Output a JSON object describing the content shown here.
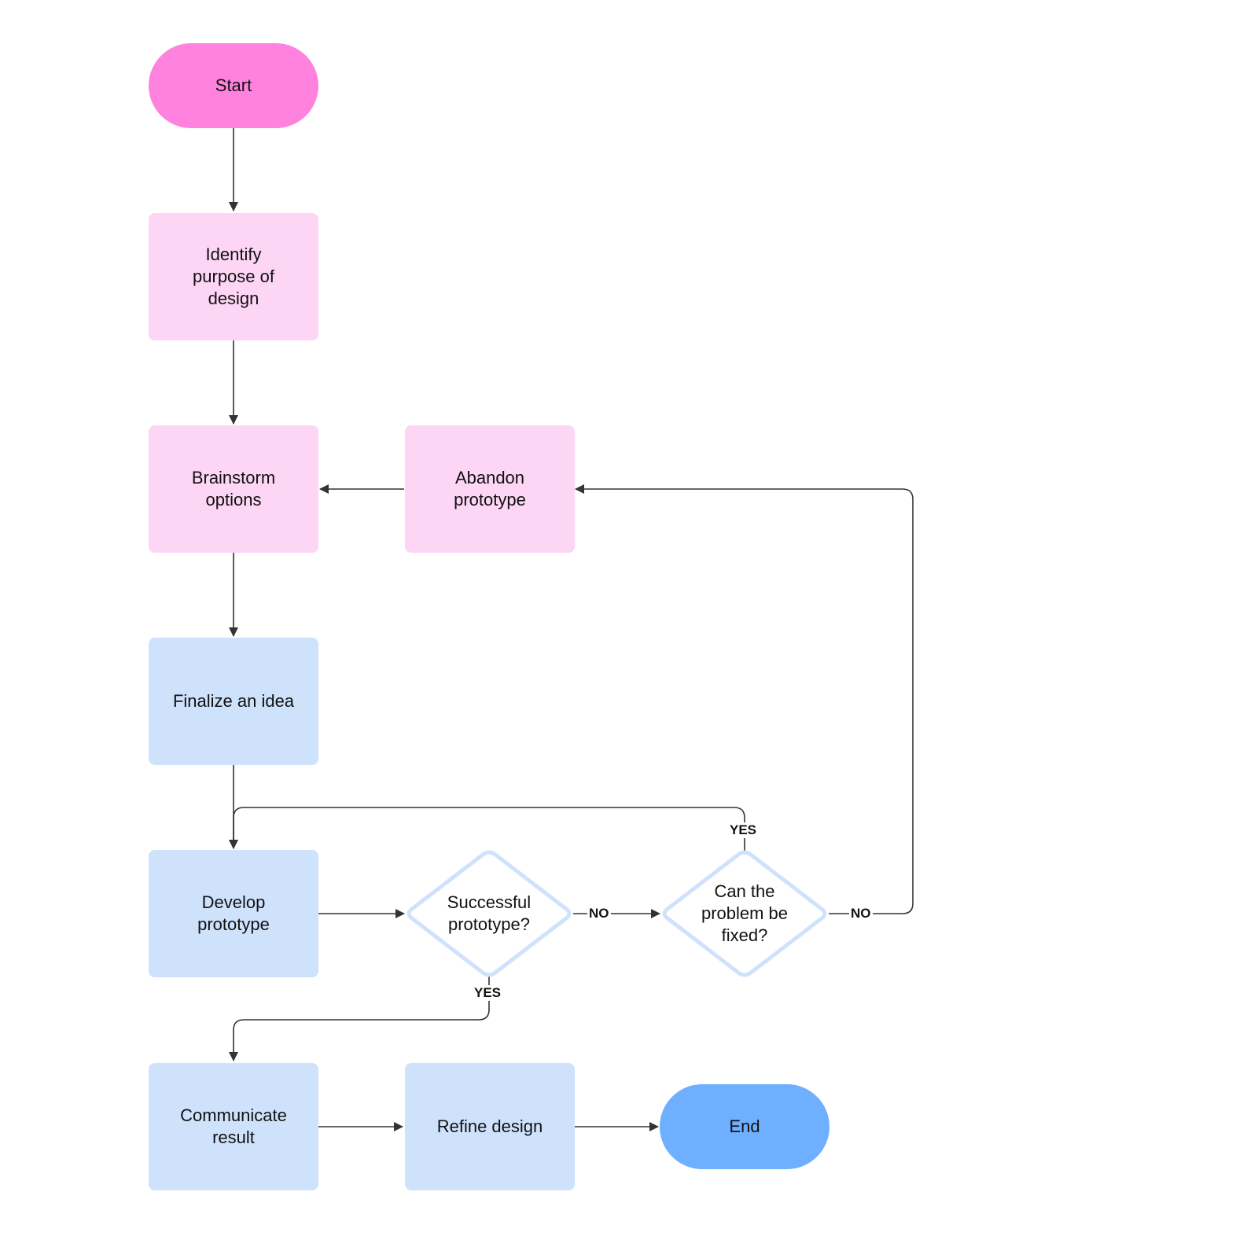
{
  "diagram": {
    "type": "flowchart",
    "colors": {
      "terminal_start": "#ff82de",
      "terminal_end": "#6eb0ff",
      "process_pink": "#fdd5f5",
      "process_blue": "#cfe2fc",
      "decision_stroke": "#cfe2fc",
      "edge": "#333333"
    },
    "nodes": {
      "start": {
        "label": "Start",
        "shape": "terminal"
      },
      "identify": {
        "label": "Identify\npurpose of\ndesign",
        "shape": "process"
      },
      "brainstorm": {
        "label": "Brainstorm\noptions",
        "shape": "process"
      },
      "abandon": {
        "label": "Abandon\nprototype",
        "shape": "process"
      },
      "finalize": {
        "label": "Finalize an idea",
        "shape": "process"
      },
      "develop": {
        "label": "Develop\nprototype",
        "shape": "process"
      },
      "successful": {
        "label": "Successful\nprototype?",
        "shape": "decision"
      },
      "fixable": {
        "label": "Can the\nproblem be\nfixed?",
        "shape": "decision"
      },
      "communicate": {
        "label": "Communicate\nresult",
        "shape": "process"
      },
      "refine": {
        "label": "Refine design",
        "shape": "process"
      },
      "end": {
        "label": "End",
        "shape": "terminal"
      }
    },
    "edges": [
      {
        "from": "start",
        "to": "identify",
        "label": ""
      },
      {
        "from": "identify",
        "to": "brainstorm",
        "label": ""
      },
      {
        "from": "brainstorm",
        "to": "finalize",
        "label": ""
      },
      {
        "from": "finalize",
        "to": "develop",
        "label": ""
      },
      {
        "from": "develop",
        "to": "successful",
        "label": ""
      },
      {
        "from": "successful",
        "to": "fixable",
        "label": "NO"
      },
      {
        "from": "successful",
        "to": "communicate",
        "label": "YES"
      },
      {
        "from": "fixable",
        "to": "develop",
        "label": "YES"
      },
      {
        "from": "fixable",
        "to": "abandon",
        "label": "NO"
      },
      {
        "from": "abandon",
        "to": "brainstorm",
        "label": ""
      },
      {
        "from": "communicate",
        "to": "refine",
        "label": ""
      },
      {
        "from": "refine",
        "to": "end",
        "label": ""
      }
    ],
    "edge_labels": {
      "successful_no": "NO",
      "successful_yes": "YES",
      "fixable_yes": "YES",
      "fixable_no": "NO"
    }
  }
}
